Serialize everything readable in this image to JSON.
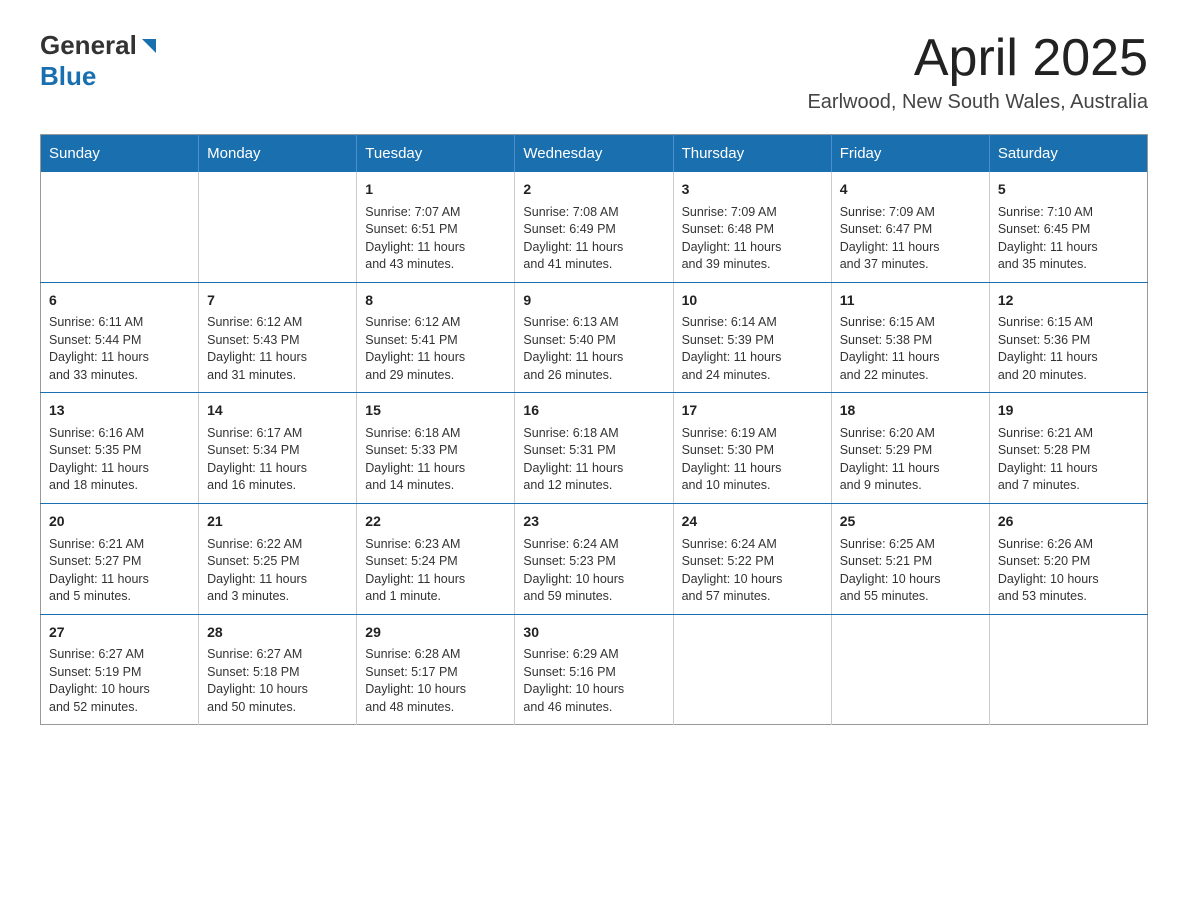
{
  "header": {
    "logo_general": "General",
    "logo_blue": "Blue",
    "month_title": "April 2025",
    "location": "Earlwood, New South Wales, Australia"
  },
  "weekdays": [
    "Sunday",
    "Monday",
    "Tuesday",
    "Wednesday",
    "Thursday",
    "Friday",
    "Saturday"
  ],
  "weeks": [
    [
      {
        "day": "",
        "info": ""
      },
      {
        "day": "",
        "info": ""
      },
      {
        "day": "1",
        "info": "Sunrise: 7:07 AM\nSunset: 6:51 PM\nDaylight: 11 hours\nand 43 minutes."
      },
      {
        "day": "2",
        "info": "Sunrise: 7:08 AM\nSunset: 6:49 PM\nDaylight: 11 hours\nand 41 minutes."
      },
      {
        "day": "3",
        "info": "Sunrise: 7:09 AM\nSunset: 6:48 PM\nDaylight: 11 hours\nand 39 minutes."
      },
      {
        "day": "4",
        "info": "Sunrise: 7:09 AM\nSunset: 6:47 PM\nDaylight: 11 hours\nand 37 minutes."
      },
      {
        "day": "5",
        "info": "Sunrise: 7:10 AM\nSunset: 6:45 PM\nDaylight: 11 hours\nand 35 minutes."
      }
    ],
    [
      {
        "day": "6",
        "info": "Sunrise: 6:11 AM\nSunset: 5:44 PM\nDaylight: 11 hours\nand 33 minutes."
      },
      {
        "day": "7",
        "info": "Sunrise: 6:12 AM\nSunset: 5:43 PM\nDaylight: 11 hours\nand 31 minutes."
      },
      {
        "day": "8",
        "info": "Sunrise: 6:12 AM\nSunset: 5:41 PM\nDaylight: 11 hours\nand 29 minutes."
      },
      {
        "day": "9",
        "info": "Sunrise: 6:13 AM\nSunset: 5:40 PM\nDaylight: 11 hours\nand 26 minutes."
      },
      {
        "day": "10",
        "info": "Sunrise: 6:14 AM\nSunset: 5:39 PM\nDaylight: 11 hours\nand 24 minutes."
      },
      {
        "day": "11",
        "info": "Sunrise: 6:15 AM\nSunset: 5:38 PM\nDaylight: 11 hours\nand 22 minutes."
      },
      {
        "day": "12",
        "info": "Sunrise: 6:15 AM\nSunset: 5:36 PM\nDaylight: 11 hours\nand 20 minutes."
      }
    ],
    [
      {
        "day": "13",
        "info": "Sunrise: 6:16 AM\nSunset: 5:35 PM\nDaylight: 11 hours\nand 18 minutes."
      },
      {
        "day": "14",
        "info": "Sunrise: 6:17 AM\nSunset: 5:34 PM\nDaylight: 11 hours\nand 16 minutes."
      },
      {
        "day": "15",
        "info": "Sunrise: 6:18 AM\nSunset: 5:33 PM\nDaylight: 11 hours\nand 14 minutes."
      },
      {
        "day": "16",
        "info": "Sunrise: 6:18 AM\nSunset: 5:31 PM\nDaylight: 11 hours\nand 12 minutes."
      },
      {
        "day": "17",
        "info": "Sunrise: 6:19 AM\nSunset: 5:30 PM\nDaylight: 11 hours\nand 10 minutes."
      },
      {
        "day": "18",
        "info": "Sunrise: 6:20 AM\nSunset: 5:29 PM\nDaylight: 11 hours\nand 9 minutes."
      },
      {
        "day": "19",
        "info": "Sunrise: 6:21 AM\nSunset: 5:28 PM\nDaylight: 11 hours\nand 7 minutes."
      }
    ],
    [
      {
        "day": "20",
        "info": "Sunrise: 6:21 AM\nSunset: 5:27 PM\nDaylight: 11 hours\nand 5 minutes."
      },
      {
        "day": "21",
        "info": "Sunrise: 6:22 AM\nSunset: 5:25 PM\nDaylight: 11 hours\nand 3 minutes."
      },
      {
        "day": "22",
        "info": "Sunrise: 6:23 AM\nSunset: 5:24 PM\nDaylight: 11 hours\nand 1 minute."
      },
      {
        "day": "23",
        "info": "Sunrise: 6:24 AM\nSunset: 5:23 PM\nDaylight: 10 hours\nand 59 minutes."
      },
      {
        "day": "24",
        "info": "Sunrise: 6:24 AM\nSunset: 5:22 PM\nDaylight: 10 hours\nand 57 minutes."
      },
      {
        "day": "25",
        "info": "Sunrise: 6:25 AM\nSunset: 5:21 PM\nDaylight: 10 hours\nand 55 minutes."
      },
      {
        "day": "26",
        "info": "Sunrise: 6:26 AM\nSunset: 5:20 PM\nDaylight: 10 hours\nand 53 minutes."
      }
    ],
    [
      {
        "day": "27",
        "info": "Sunrise: 6:27 AM\nSunset: 5:19 PM\nDaylight: 10 hours\nand 52 minutes."
      },
      {
        "day": "28",
        "info": "Sunrise: 6:27 AM\nSunset: 5:18 PM\nDaylight: 10 hours\nand 50 minutes."
      },
      {
        "day": "29",
        "info": "Sunrise: 6:28 AM\nSunset: 5:17 PM\nDaylight: 10 hours\nand 48 minutes."
      },
      {
        "day": "30",
        "info": "Sunrise: 6:29 AM\nSunset: 5:16 PM\nDaylight: 10 hours\nand 46 minutes."
      },
      {
        "day": "",
        "info": ""
      },
      {
        "day": "",
        "info": ""
      },
      {
        "day": "",
        "info": ""
      }
    ]
  ]
}
